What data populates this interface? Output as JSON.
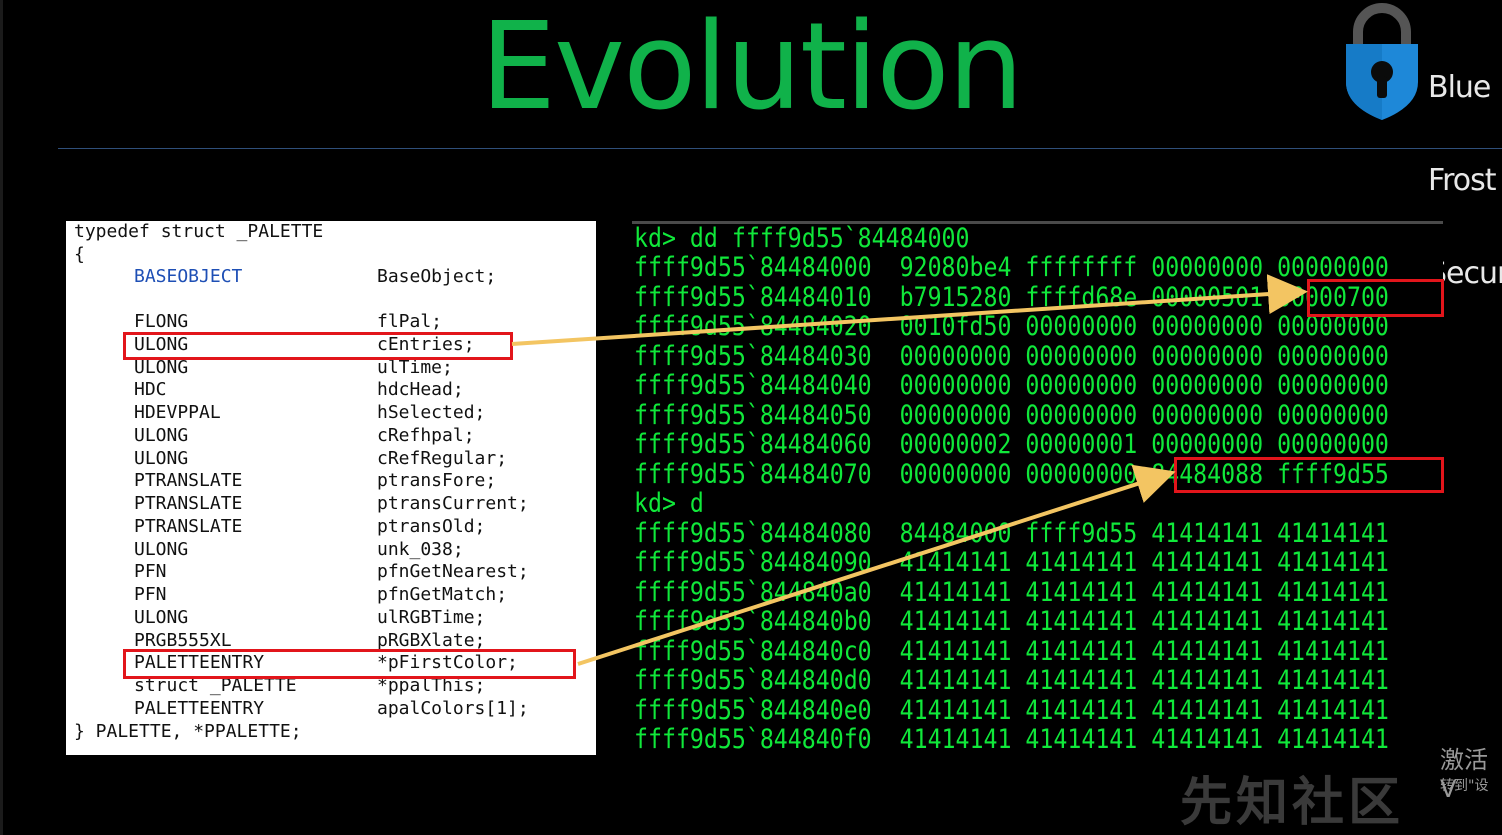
{
  "slide": {
    "title": "Evolution",
    "logo": {
      "lines": [
        "Blue",
        "Frost",
        "Secur"
      ]
    }
  },
  "code": {
    "lines": [
      {
        "type": "typedef struct _PALETTE",
        "field": ""
      },
      {
        "type": "{",
        "field": ""
      },
      {
        "type": "BASEOBJECT",
        "field": "BaseObject;"
      },
      {
        "type": "",
        "field": ""
      },
      {
        "type": "FLONG",
        "field": "flPal;"
      },
      {
        "type": "ULONG",
        "field": "cEntries;"
      },
      {
        "type": "ULONG",
        "field": "ulTime;"
      },
      {
        "type": "HDC",
        "field": "hdcHead;"
      },
      {
        "type": "HDEVPPAL",
        "field": "hSelected;"
      },
      {
        "type": "ULONG",
        "field": "cRefhpal;"
      },
      {
        "type": "ULONG",
        "field": "cRefRegular;"
      },
      {
        "type": "PTRANSLATE",
        "field": "ptransFore;"
      },
      {
        "type": "PTRANSLATE",
        "field": "ptransCurrent;"
      },
      {
        "type": "PTRANSLATE",
        "field": "ptransOld;"
      },
      {
        "type": "ULONG",
        "field": "unk_038;"
      },
      {
        "type": "PFN",
        "field": "pfnGetNearest;"
      },
      {
        "type": "PFN",
        "field": "pfnGetMatch;"
      },
      {
        "type": "ULONG",
        "field": "ulRGBTime;"
      },
      {
        "type": "PRGB555XL",
        "field": "pRGBXlate;"
      },
      {
        "type": "PALETTEENTRY",
        "field": "*pFirstColor;"
      },
      {
        "type": "struct _PALETTE",
        "field": "*ppalThis;"
      },
      {
        "type": "PALETTEENTRY",
        "field": "apalColors[1];"
      },
      {
        "type": "} PALETTE, *PPALETTE;",
        "field": ""
      }
    ]
  },
  "terminal": {
    "lines": [
      "kd> dd ffff9d55`84484000",
      "ffff9d55`84484000  92080be4 ffffffff 00000000 00000000",
      "ffff9d55`84484010  b7915280 ffffd68e 00000501 00000700",
      "ffff9d55`84484020  0010fd50 00000000 00000000 00000000",
      "ffff9d55`84484030  00000000 00000000 00000000 00000000",
      "ffff9d55`84484040  00000000 00000000 00000000 00000000",
      "ffff9d55`84484050  00000000 00000000 00000000 00000000",
      "ffff9d55`84484060  00000002 00000001 00000000 00000000",
      "ffff9d55`84484070  00000000 00000000 84484088 ffff9d55",
      "kd> d",
      "ffff9d55`84484080  84484000 ffff9d55 41414141 41414141",
      "ffff9d55`84484090  41414141 41414141 41414141 41414141",
      "ffff9d55`844840a0  41414141 41414141 41414141 41414141",
      "ffff9d55`844840b0  41414141 41414141 41414141 41414141",
      "ffff9d55`844840c0  41414141 41414141 41414141 41414141",
      "ffff9d55`844840d0  41414141 41414141 41414141 41414141",
      "ffff9d55`844840e0  41414141 41414141 41414141 41414141",
      "ffff9d55`844840f0  41414141 41414141 41414141 41414141"
    ]
  },
  "colors": {
    "title": "#10b24a",
    "terminal_text": "#10e83a",
    "highlight_box": "#e2151b",
    "arrow": "#f3c562",
    "keyword": "#1e4fb5"
  },
  "watermark": {
    "line1": "激活 V",
    "line2": "转到\"设",
    "brand": "先知社区"
  }
}
